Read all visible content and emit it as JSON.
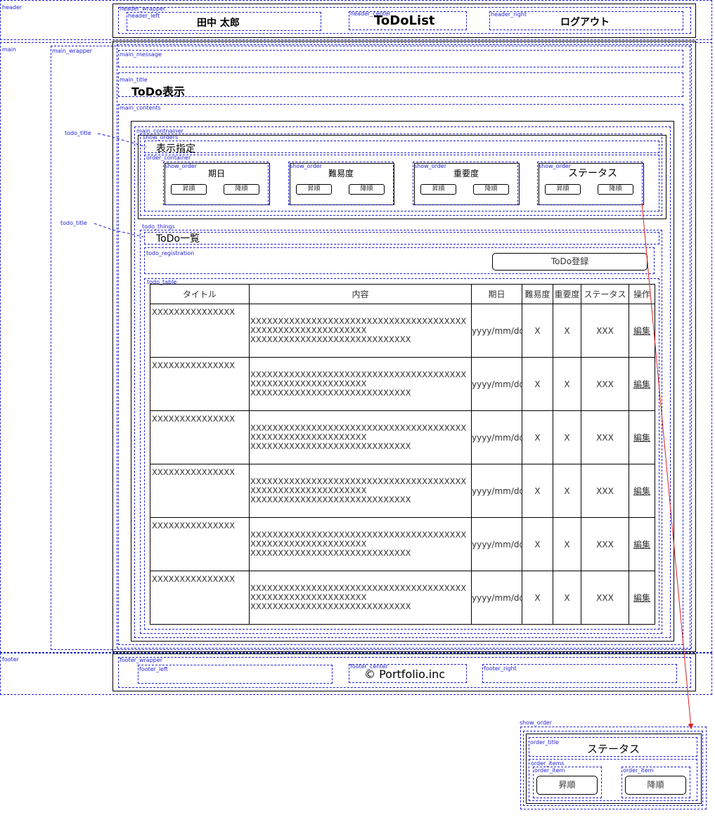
{
  "labels": {
    "header": "header",
    "header_wrapper": "header_wrapper",
    "header_left": "header_left",
    "header_center": "header_center",
    "header_right": "header_right",
    "main": "main",
    "main_wrapper": "main_wrapper",
    "main_message": "main_message",
    "main_title": "main_title",
    "main_contents": "main_contents",
    "main_container": "main_contnainer",
    "show_orders": "show_orders",
    "order_container": "order_container",
    "show_order": "show_order",
    "todo_title": "todo_title",
    "todo_things": "todo_things",
    "todo_registration": "todo_registration",
    "todo_table": "todo_table",
    "footer": "footer",
    "footer_wrapper": "footer_wrapper",
    "footer_left": "footer_left",
    "footer_center": "footer_center",
    "footer_right": "footer_right",
    "order_title": "order_title",
    "order_items": "order_items",
    "order_item": "order_item"
  },
  "header": {
    "user_name": "田中 太郎",
    "app_title": "ToDoList",
    "logout": "ログアウト"
  },
  "main": {
    "page_title": "ToDo表示",
    "order_heading": "表示指定",
    "orders": [
      {
        "name": "期日",
        "asc": "昇順",
        "desc": "降順"
      },
      {
        "name": "難易度",
        "asc": "昇順",
        "desc": "降順"
      },
      {
        "name": "重要度",
        "asc": "昇順",
        "desc": "降順"
      },
      {
        "name": "ステータス",
        "asc": "昇順",
        "desc": "降順"
      }
    ],
    "list_heading": "ToDo一覧",
    "register_button": "ToDo登録",
    "table": {
      "headers": [
        "タイトル",
        "内容",
        "期日",
        "難易度",
        "重要度",
        "ステータス",
        "操作"
      ],
      "rows": [
        {
          "title": "XXXXXXXXXXXXXXX",
          "body1": "XXXXXXXXXXXXXXXXXXXXXXXXXXXXXXXXXXXXXXX",
          "body2": "XXXXXXXXXXXXXXXXXXXXX",
          "body3": "XXXXXXXXXXXXXXXXXXXXXXXXXXXXX",
          "date": "yyyy/mm/dd",
          "difficulty": "X",
          "importance": "X",
          "status": "XXX",
          "action": "編集"
        },
        {
          "title": "XXXXXXXXXXXXXXX",
          "body1": "XXXXXXXXXXXXXXXXXXXXXXXXXXXXXXXXXXXXXXX",
          "body2": "XXXXXXXXXXXXXXXXXXXXX",
          "body3": "XXXXXXXXXXXXXXXXXXXXXXXXXXXXX",
          "date": "yyyy/mm/dd",
          "difficulty": "X",
          "importance": "X",
          "status": "XXX",
          "action": "編集"
        },
        {
          "title": "XXXXXXXXXXXXXXX",
          "body1": "XXXXXXXXXXXXXXXXXXXXXXXXXXXXXXXXXXXXXXX",
          "body2": "XXXXXXXXXXXXXXXXXXXXX",
          "body3": "XXXXXXXXXXXXXXXXXXXXXXXXXXXXX",
          "date": "yyyy/mm/dd",
          "difficulty": "X",
          "importance": "X",
          "status": "XXX",
          "action": "編集"
        },
        {
          "title": "XXXXXXXXXXXXXXX",
          "body1": "XXXXXXXXXXXXXXXXXXXXXXXXXXXXXXXXXXXXXXX",
          "body2": "XXXXXXXXXXXXXXXXXXXXX",
          "body3": "XXXXXXXXXXXXXXXXXXXXXXXXXXXXX",
          "date": "yyyy/mm/dd",
          "difficulty": "X",
          "importance": "X",
          "status": "XXX",
          "action": "編集"
        },
        {
          "title": "XXXXXXXXXXXXXXX",
          "body1": "XXXXXXXXXXXXXXXXXXXXXXXXXXXXXXXXXXXXXXX",
          "body2": "XXXXXXXXXXXXXXXXXXXXX",
          "body3": "XXXXXXXXXXXXXXXXXXXXXXXXXXXXX",
          "date": "yyyy/mm/dd",
          "difficulty": "X",
          "importance": "X",
          "status": "XXX",
          "action": "編集"
        },
        {
          "title": "XXXXXXXXXXXXXXX",
          "body1": "XXXXXXXXXXXXXXXXXXXXXXXXXXXXXXXXXXXXXXX",
          "body2": "XXXXXXXXXXXXXXXXXXXXX",
          "body3": "XXXXXXXXXXXXXXXXXXXXXXXXXXXXX",
          "date": "yyyy/mm/dd",
          "difficulty": "X",
          "importance": "X",
          "status": "XXX",
          "action": "編集"
        }
      ]
    }
  },
  "footer": {
    "copyright": "© Portfolio.inc"
  },
  "detail": {
    "title": "ステータス",
    "asc": "昇順",
    "desc": "降順"
  },
  "colors": {
    "annotation": "#1f1fd6",
    "arrow": "#e02020"
  }
}
